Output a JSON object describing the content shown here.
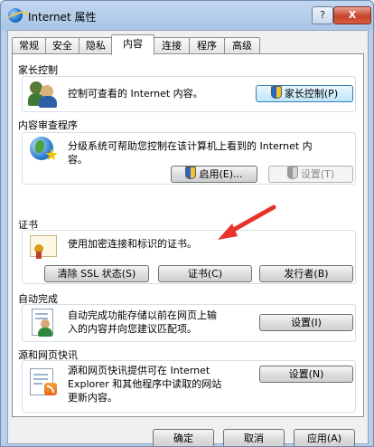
{
  "window": {
    "title": "Internet 属性",
    "help_label": "?",
    "close_label": "X"
  },
  "tabs": [
    {
      "label": "常规"
    },
    {
      "label": "安全"
    },
    {
      "label": "隐私"
    },
    {
      "label": "内容"
    },
    {
      "label": "连接"
    },
    {
      "label": "程序"
    },
    {
      "label": "高级"
    }
  ],
  "active_tab": "内容",
  "sections": {
    "parental": {
      "title": "家长控制",
      "description": "控制可查看的 Internet 内容。",
      "button": "家长控制(P)"
    },
    "advisor": {
      "title": "内容审查程序",
      "description_line1": "分级系统可帮助您控制在该计算机上看到的 Internet 内",
      "description_line2": "容。",
      "enable_button": "启用(E)...",
      "settings_button": "设置(T)"
    },
    "certificates": {
      "title": "证书",
      "description": "使用加密连接和标识的证书。",
      "clear_ssl_button": "清除 SSL 状态(S)",
      "certificates_button": "证书(C)",
      "publishers_button": "发行者(B)"
    },
    "autocomplete": {
      "title": "自动完成",
      "description_line1": "自动完成功能存储以前在网页上输",
      "description_line2": "入的内容并向您建议匹配项。",
      "settings_button": "设置(I)"
    },
    "feeds": {
      "title": "源和网页快讯",
      "description_line1": "源和网页快讯提供可在 Internet",
      "description_line2": "Explorer 和其他程序中读取的网站",
      "description_line3": "更新内容。",
      "settings_button": "设置(N)"
    }
  },
  "footer": {
    "ok_button": "确定",
    "cancel_button": "取消",
    "apply_button": "应用(A)"
  },
  "colors": {
    "arrow": "#e8322b",
    "title_bar": "#b9cfe8",
    "close_button": "#c7422a"
  }
}
